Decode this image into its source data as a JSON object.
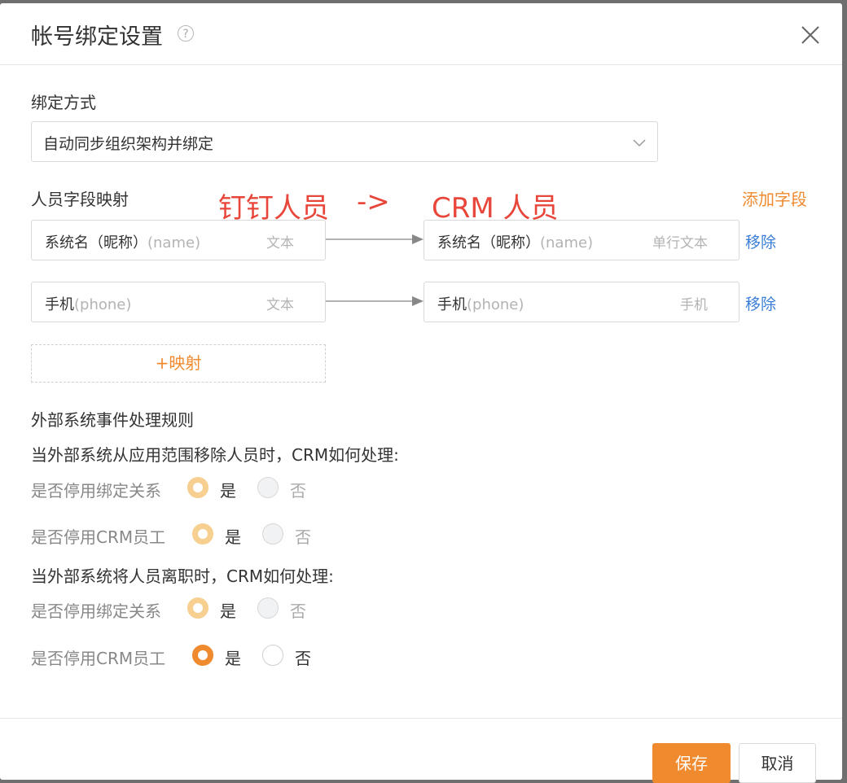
{
  "dialog": {
    "title": "帐号绑定设置",
    "help_icon": "question-circle-icon",
    "close_icon": "close-icon"
  },
  "binding": {
    "label": "绑定方式",
    "selected": "自动同步组织架构并绑定"
  },
  "mapping": {
    "label": "人员字段映射",
    "annotation_left": "钉钉人员",
    "annotation_arrow": "->",
    "annotation_right": "CRM 人员",
    "add_field": "添加字段",
    "rows": [
      {
        "left_name": "系统名（昵称）",
        "left_code": "(name)",
        "left_type": "文本",
        "right_name": "系统名（昵称）",
        "right_code": "(name)",
        "right_type": "单行文本",
        "remove": "移除"
      },
      {
        "left_name": "手机",
        "left_code": "(phone)",
        "left_type": "文本",
        "right_name": "手机",
        "right_code": "(phone)",
        "right_type": "手机",
        "remove": "移除"
      }
    ],
    "add_mapping": "+映射"
  },
  "rules": {
    "label": "外部系统事件处理规则",
    "sections": [
      {
        "question": "当外部系统从应用范围移除人员时，CRM如何处理:",
        "options": [
          {
            "label": "是否停用绑定关系",
            "yes": "是",
            "no": "否",
            "value": "是",
            "disabled": true
          },
          {
            "label": "是否停用CRM员工",
            "yes": "是",
            "no": "否",
            "value": "是",
            "disabled": true
          }
        ]
      },
      {
        "question": "当外部系统将人员离职时，CRM如何处理:",
        "options": [
          {
            "label": "是否停用绑定关系",
            "yes": "是",
            "no": "否",
            "value": "是",
            "disabled": true
          },
          {
            "label": "是否停用CRM员工",
            "yes": "是",
            "no": "否",
            "value": "是",
            "disabled": false
          }
        ]
      }
    ]
  },
  "footer": {
    "save": "保存",
    "cancel": "取消"
  },
  "colors": {
    "accent": "#f08a2e",
    "link": "#3b7ed8",
    "annotation": "#e8463a"
  }
}
